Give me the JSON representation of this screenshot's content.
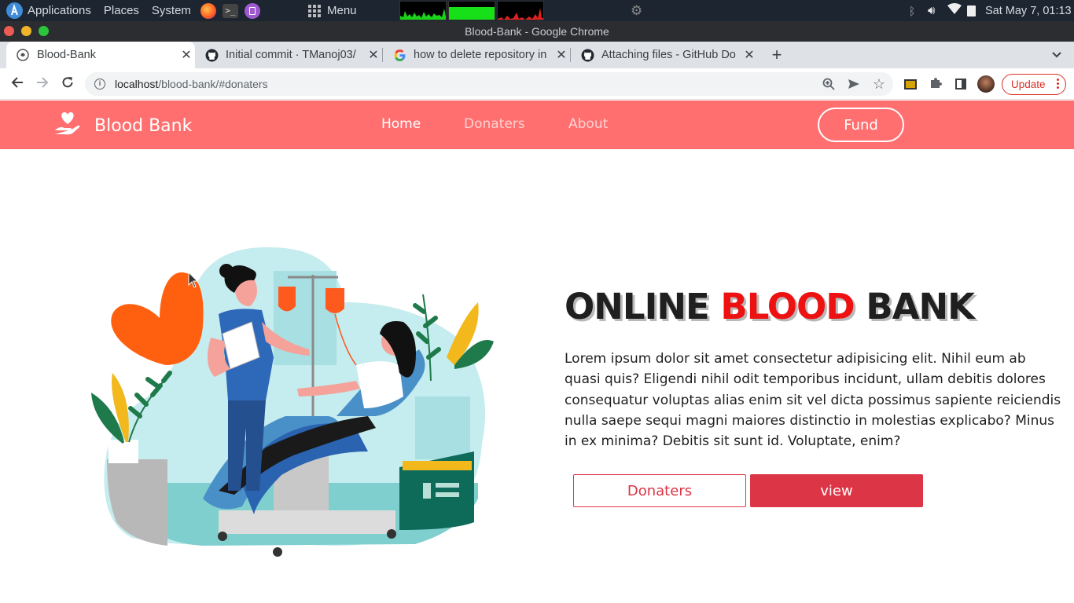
{
  "os_panel": {
    "applications": "Applications",
    "places": "Places",
    "system": "System",
    "menu": "Menu",
    "datetime": "Sat May  7, 01:13"
  },
  "window": {
    "title": "Blood-Bank - Google Chrome"
  },
  "tabs": [
    {
      "title": "Blood-Bank",
      "icon": "bloodbank-favicon",
      "active": true
    },
    {
      "title": "Initial commit · TManoj03/",
      "icon": "github-icon",
      "active": false
    },
    {
      "title": "how to delete repository in",
      "icon": "google-icon",
      "active": false
    },
    {
      "title": "Attaching files - GitHub Do",
      "icon": "github-icon",
      "active": false
    }
  ],
  "address_bar": {
    "host": "localhost",
    "path": "/blood-bank/#donaters"
  },
  "browser": {
    "update_label": "Update"
  },
  "site": {
    "brand": "Blood Bank",
    "nav": [
      "Home",
      "Donaters",
      "About"
    ],
    "fund_label": "Fund",
    "hero": {
      "title_part1": "ONLINE",
      "title_part2": "BLOOD",
      "title_part3": "BANK",
      "description": "Lorem ipsum dolor sit amet consectetur adipisicing elit. Nihil eum ab quasi quis? Eligendi nihil odit temporibus incidunt, ullam debitis dolores consequatur voluptas alias enim sit vel dicta possimus sapiente reiciendis nulla saepe sequi magni maiores distinctio in molestias explicabo? Minus in ex minima? Debitis sit sunt id. Voluptate, enim?",
      "donaters_button": "Donaters",
      "view_button": "view"
    },
    "colors": {
      "nav_bg": "#ff6f6f",
      "accent_red": "#dc3545",
      "title_red": "#ee1111"
    }
  }
}
